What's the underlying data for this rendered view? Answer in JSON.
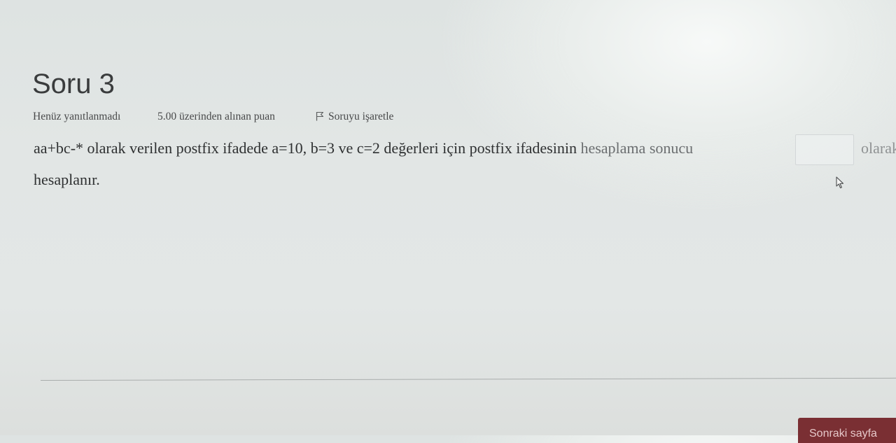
{
  "question": {
    "title": "Soru 3",
    "state": "Henüz yanıtlanmadı",
    "grade": "5.00 üzerinden alınan puan",
    "flag_label": "Soruyu işaretle",
    "flag_icon": "flag-icon",
    "text_main": "aa+bc-* olarak verilen postfix ifadede a=10, b=3 ve c=2 değerleri için postfix ifadesinin ",
    "text_faint": "hesaplama sonucu",
    "answer_value": "",
    "text_after": "olarak",
    "text_end": "hesaplanır."
  },
  "navigation": {
    "next_label": "Sonraki sayfa",
    "next_color": "#7a2f33"
  },
  "cursor_icon": "mouse-pointer-icon"
}
